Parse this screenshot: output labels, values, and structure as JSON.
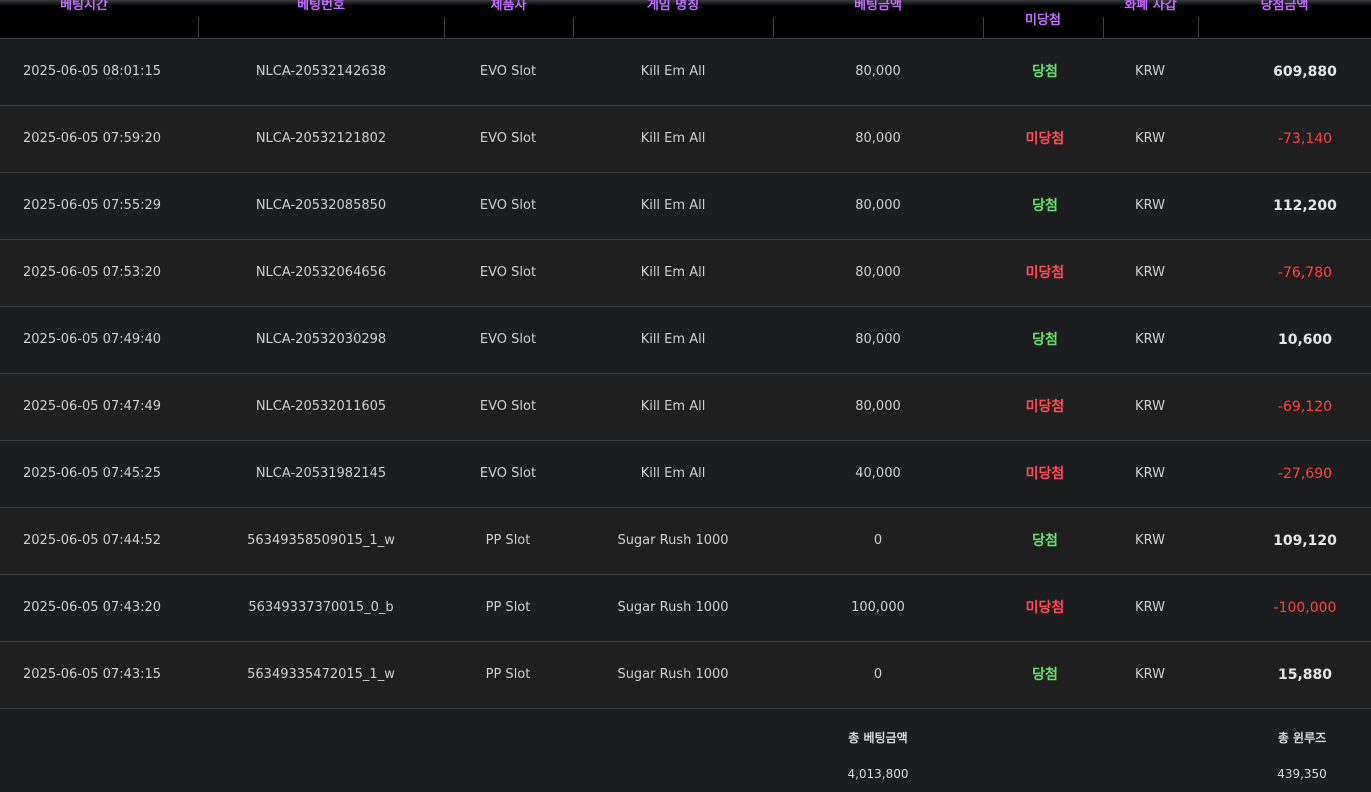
{
  "header": {
    "columns": [
      "베팅시간",
      "베팅번호",
      "제품사",
      "게임 명칭",
      "베팅금액",
      "미당첨",
      "화폐 사갑",
      "당첨금액"
    ]
  },
  "rows": [
    {
      "time": "2025-06-05 08:01:15",
      "bet_id": "NLCA-20532142638",
      "provider": "EVO Slot",
      "game": "Kill Em All",
      "bet_amount": "80,000",
      "status": "당첨",
      "result": "win",
      "currency": "KRW",
      "win_amount": "609,880"
    },
    {
      "time": "2025-06-05 07:59:20",
      "bet_id": "NLCA-20532121802",
      "provider": "EVO Slot",
      "game": "Kill Em All",
      "bet_amount": "80,000",
      "status": "미당첨",
      "result": "lose",
      "currency": "KRW",
      "win_amount": "-73,140"
    },
    {
      "time": "2025-06-05 07:55:29",
      "bet_id": "NLCA-20532085850",
      "provider": "EVO Slot",
      "game": "Kill Em All",
      "bet_amount": "80,000",
      "status": "당첨",
      "result": "win",
      "currency": "KRW",
      "win_amount": "112,200"
    },
    {
      "time": "2025-06-05 07:53:20",
      "bet_id": "NLCA-20532064656",
      "provider": "EVO Slot",
      "game": "Kill Em All",
      "bet_amount": "80,000",
      "status": "미당첨",
      "result": "lose",
      "currency": "KRW",
      "win_amount": "-76,780"
    },
    {
      "time": "2025-06-05 07:49:40",
      "bet_id": "NLCA-20532030298",
      "provider": "EVO Slot",
      "game": "Kill Em All",
      "bet_amount": "80,000",
      "status": "당첨",
      "result": "win",
      "currency": "KRW",
      "win_amount": "10,600"
    },
    {
      "time": "2025-06-05 07:47:49",
      "bet_id": "NLCA-20532011605",
      "provider": "EVO Slot",
      "game": "Kill Em All",
      "bet_amount": "80,000",
      "status": "미당첨",
      "result": "lose",
      "currency": "KRW",
      "win_amount": "-69,120"
    },
    {
      "time": "2025-06-05 07:45:25",
      "bet_id": "NLCA-20531982145",
      "provider": "EVO Slot",
      "game": "Kill Em All",
      "bet_amount": "40,000",
      "status": "미당첨",
      "result": "lose",
      "currency": "KRW",
      "win_amount": "-27,690"
    },
    {
      "time": "2025-06-05 07:44:52",
      "bet_id": "56349358509015_1_w",
      "provider": "PP Slot",
      "game": "Sugar Rush 1000",
      "bet_amount": "0",
      "status": "당첨",
      "result": "win",
      "currency": "KRW",
      "win_amount": "109,120"
    },
    {
      "time": "2025-06-05 07:43:20",
      "bet_id": "56349337370015_0_b",
      "provider": "PP Slot",
      "game": "Sugar Rush 1000",
      "bet_amount": "100,000",
      "status": "미당첨",
      "result": "lose",
      "currency": "KRW",
      "win_amount": "-100,000"
    },
    {
      "time": "2025-06-05 07:43:15",
      "bet_id": "56349335472015_1_w",
      "provider": "PP Slot",
      "game": "Sugar Rush 1000",
      "bet_amount": "0",
      "status": "당첨",
      "result": "win",
      "currency": "KRW",
      "win_amount": "15,880"
    }
  ],
  "footer": {
    "total_bet_label": "총 베팅금액",
    "total_bet_value": "4,013,800",
    "total_winloss_label": "총 윈루즈",
    "total_winloss_value": "439,350"
  },
  "colors": {
    "header_text": "#c46bff",
    "win_status": "#66e06e",
    "lose_status": "#ff4a57",
    "negative_amount": "#ff4040"
  }
}
